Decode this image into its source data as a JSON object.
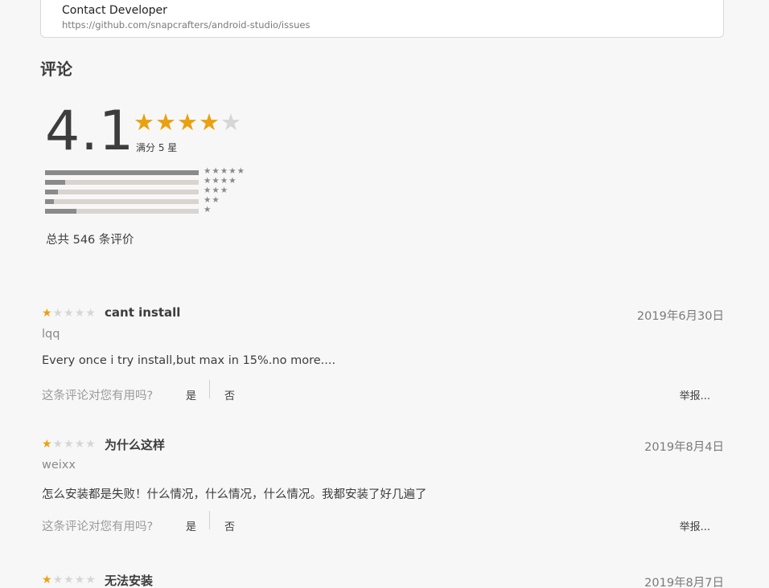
{
  "contact": {
    "title": "Contact Developer",
    "url": "https://github.com/snapcrafters/android-studio/issues"
  },
  "reviews_section": {
    "title": "评论",
    "average": "4.1",
    "average_stars": 4,
    "out_of": "满分 5 星",
    "histogram": [
      {
        "stars": "★★★★★",
        "fraction": 1.0
      },
      {
        "stars": "★★★★",
        "fraction": 0.13
      },
      {
        "stars": "★★★",
        "fraction": 0.085
      },
      {
        "stars": "★★",
        "fraction": 0.055
      },
      {
        "stars": "★",
        "fraction": 0.205
      }
    ],
    "total": "总共 546 条评价"
  },
  "colors": {
    "star_filled": "#e9a10f",
    "star_empty": "#d6d6d6",
    "bar_fill": "#8a8a8a",
    "bar_track": "#d8d4d0"
  },
  "helpful_prompt": "这条评论对您有用吗?",
  "yes_label": "是",
  "no_label": "否",
  "report_label": "举报...",
  "reviews": [
    {
      "rating": 1,
      "title": "cant install",
      "date": "2019年6月30日",
      "author": "lqq",
      "body": "Every once i try install,but max in 15%.no more...."
    },
    {
      "rating": 1,
      "title": "为什么这样",
      "date": "2019年8月4日",
      "author": "weixx",
      "body": "怎么安装都是失败！什么情况，什么情况，什么情况。我都安装了好几遍了"
    },
    {
      "rating": 1,
      "title": "无法安装",
      "date": "2019年8月7日",
      "author": "",
      "body": ""
    }
  ]
}
